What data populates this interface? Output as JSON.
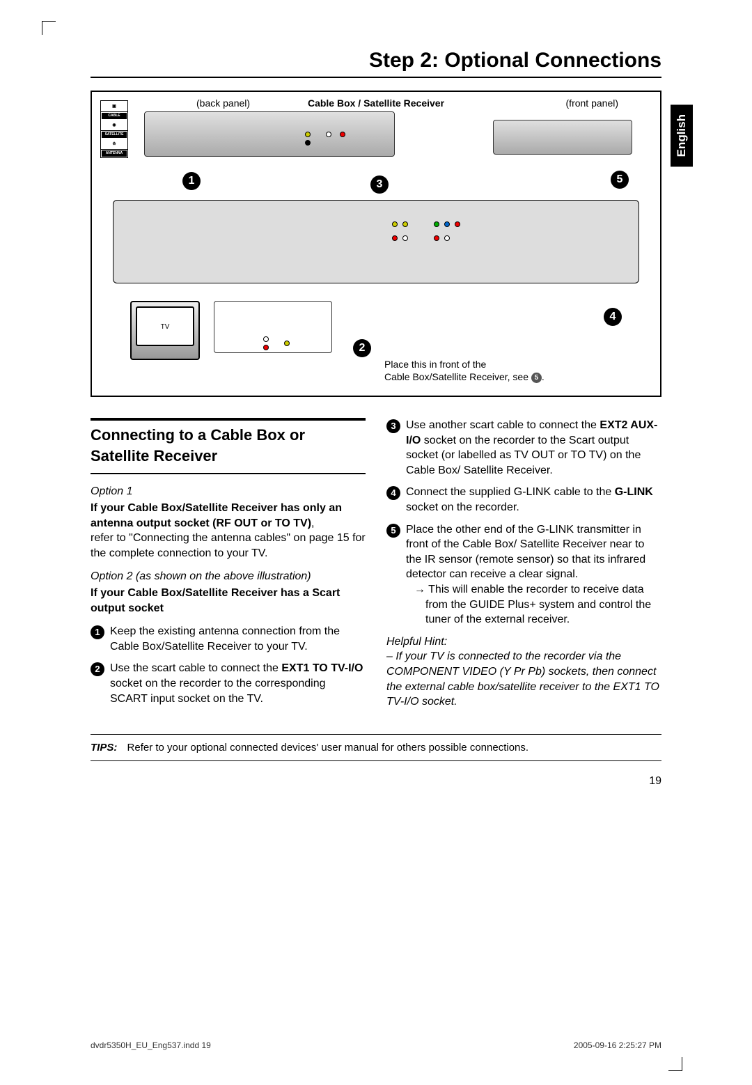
{
  "page_title": "Step 2: Optional Connections",
  "language_tab": "English",
  "diagram": {
    "top_center": "Cable Box / Satellite Receiver",
    "back_panel": "(back panel)",
    "front_panel": "(front panel)",
    "tv_label": "TV",
    "sidebar": {
      "cable": "CABLE",
      "satellite": "SATELLITE",
      "antenna": "ANTENNA"
    },
    "bubbles": {
      "b1": "1",
      "b2": "2",
      "b3": "3",
      "b4": "4",
      "b5": "5"
    },
    "note_line1": "Place this in front of the",
    "note_line2": "Cable Box/Satellite Receiver, see",
    "note_bubble": "5",
    "note_period": "."
  },
  "section_heading": "Connecting to a Cable Box or Satellite Receiver",
  "option1_label": "Option 1",
  "option1_bold": "If your Cable Box/Satellite Receiver has only an antenna output socket (RF OUT or TO TV)",
  "option1_bold_comma": ",",
  "option1_text": "refer to \"Connecting the antenna cables\" on page 15 for the complete connection to your TV.",
  "option2_label": "Option 2 (as shown on the above illustration)",
  "option2_bold": "If your Cable Box/Satellite Receiver has a Scart output socket",
  "steps": {
    "s1": {
      "num": "1",
      "text": "Keep the existing antenna connection from the Cable Box/Satellite Receiver to your TV."
    },
    "s2": {
      "num": "2",
      "pre": "Use the scart cable to connect the ",
      "bold": "EXT1 TO TV-I/O",
      "post": " socket on the recorder to the corresponding SCART input socket on the TV."
    },
    "s3": {
      "num": "3",
      "pre": "Use another scart cable to connect the ",
      "bold": "EXT2 AUX-I/O",
      "post": " socket on the recorder to the Scart output socket (or labelled as TV OUT or TO TV) on the Cable Box/ Satellite Receiver."
    },
    "s4": {
      "num": "4",
      "pre": "Connect the supplied G-LINK cable to the ",
      "bold": "G-LINK",
      "post": " socket on the recorder."
    },
    "s5": {
      "num": "5",
      "pre": "Place the other end of the G-LINK transmitter in front of the Cable Box/ Satellite Receiver near to the IR sensor (remote sensor) so that its infrared detector can receive a clear signal.",
      "arrow": "→ This will enable the recorder to receive data from the GUIDE Plus+ system and control the tuner of the external receiver."
    }
  },
  "hint_heading": "Helpful Hint:",
  "hint_text": "– If your TV is connected to the recorder via the COMPONENT VIDEO (Y Pr Pb) sockets, then connect the external cable box/satellite receiver to the EXT1 TO TV-I/O socket.",
  "tips_label": "TIPS:",
  "tips_text": "Refer to your optional connected devices' user manual for others possible connections.",
  "page_number": "19",
  "footer_left": "dvdr5350H_EU_Eng537.indd   19",
  "footer_right": "2005-09-16   2:25:27 PM"
}
